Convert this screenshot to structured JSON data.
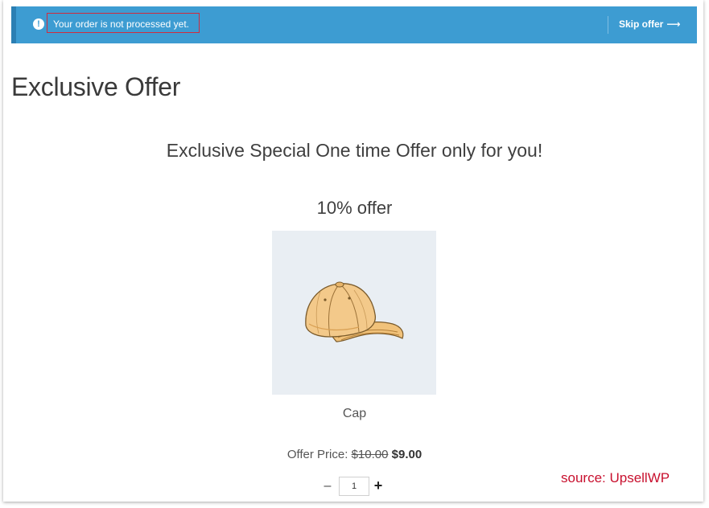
{
  "notice": {
    "icon": "exclamation-icon",
    "message": "Your order is not processed yet.",
    "skip_label": "Skip offer",
    "skip_arrow": "⟶",
    "background_color": "#3d9cd2",
    "highlight_color": "#d12b3d"
  },
  "page": {
    "title": "Exclusive Offer",
    "offer_heading": "Exclusive Special One time Offer only for you!",
    "offer_sub": "10% offer"
  },
  "product": {
    "image_icon": "cap-icon",
    "name": "Cap",
    "price_label": "Offer Price:",
    "old_price": "$10.00",
    "new_price": "$9.00"
  },
  "quantity": {
    "minus": "–",
    "value": "1",
    "plus": "+"
  },
  "watermark": {
    "text": "source: UpsellWP",
    "color": "#c8102e"
  }
}
